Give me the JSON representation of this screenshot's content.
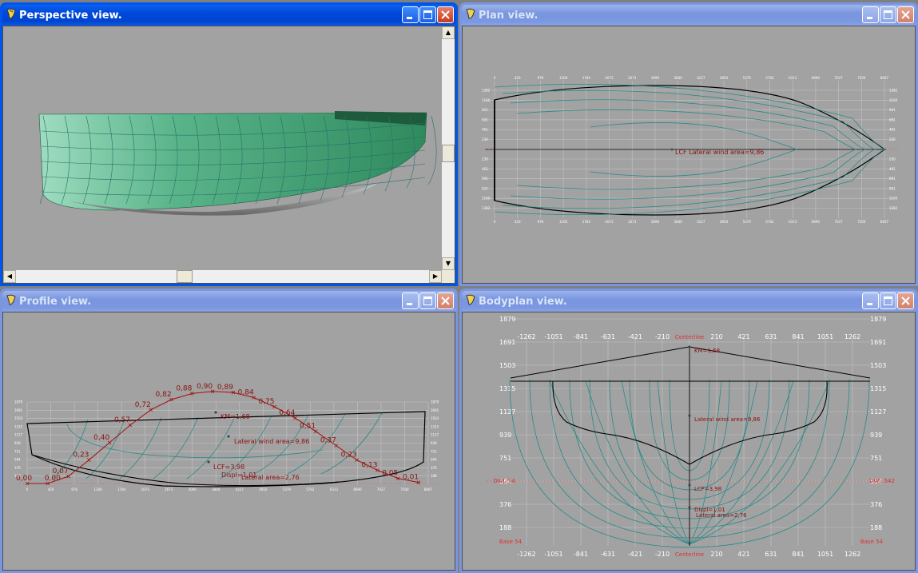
{
  "windows": {
    "perspective": {
      "title": "Perspective view."
    },
    "plan": {
      "title": "Plan view.",
      "x_ticks": [
        "0",
        "420",
        "978",
        "1200",
        "1784",
        "2073",
        "2673",
        "3090",
        "3840",
        "4227",
        "4950",
        "5379",
        "5762",
        "6313",
        "6690",
        "7027",
        "7500",
        "8007"
      ],
      "y_ticks_top": [
        "1382",
        "1160",
        "921",
        "691",
        "461",
        "230"
      ],
      "y_ticks_bottom": [
        "230",
        "461",
        "691",
        "921",
        "1160",
        "1382"
      ],
      "annotation": "LCF Lateral wind area=9,86"
    },
    "profile": {
      "title": "Profile view.",
      "curve_labels": [
        "0,00",
        "0,00",
        "0,07",
        "0,23",
        "0,40",
        "0,57",
        "0,72",
        "0,82",
        "0,88",
        "0,90",
        "0,89",
        "0,84",
        "0,75",
        "0,64",
        "0,51",
        "0,37",
        "0,23",
        "0,13",
        "0,05",
        "0,01"
      ],
      "y_ticks": [
        "1879",
        "1691",
        "1503",
        "1315",
        "1127",
        "939",
        "751",
        "564",
        "376",
        "188"
      ],
      "x_ticks": [
        "0",
        "420",
        "978",
        "1200",
        "1784",
        "2073",
        "2673",
        "3090",
        "3840",
        "4227",
        "4950",
        "5379",
        "5762",
        "6313",
        "6690",
        "7027",
        "7500",
        "8007"
      ],
      "km_label": "KM=1,68",
      "wind_label": "Lateral wind area=9,86",
      "lcf_label": "LCF=3,98",
      "displ_label": "Displ=1,01",
      "lateral_label": "Lateral area=2,76"
    },
    "bodyplan": {
      "title": "Bodyplan view.",
      "y_ticks": [
        "1879",
        "1691",
        "1503",
        "1315",
        "1127",
        "939",
        "751",
        "564",
        "376",
        "188"
      ],
      "x_ticks": [
        "-1262",
        "-1051",
        "-841",
        "-631",
        "-421",
        "-210",
        "Centerline",
        "210",
        "421",
        "631",
        "841",
        "1051",
        "1262"
      ],
      "centerline_label": "Centerline",
      "dwl_left": "DWL 54",
      "dwl_right": "DWL 542",
      "base_left": "Base 54",
      "base_right": "Base 54",
      "km_label": "KM=1,68",
      "wind_label": "Lateral wind area=9,86",
      "lcf_label": "LCF=3,98",
      "displ_label": "Displ=1,01",
      "lateral_label": "Lateral area=2,76"
    }
  },
  "colors": {
    "title_active": "#0055ea",
    "title_inactive": "#7a96df",
    "canvas": "#a2a2a2",
    "hull_line": "#2a8a8a",
    "outline": "#000000",
    "curve": "#a01010",
    "hull_fill": "#3e9a6e"
  }
}
